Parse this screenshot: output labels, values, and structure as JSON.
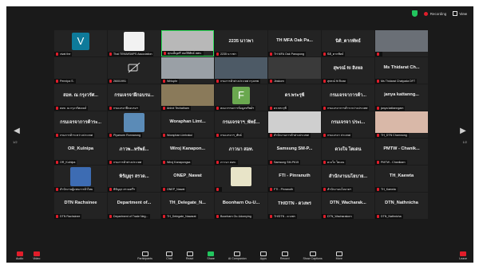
{
  "topbar": {
    "recording_label": "Recording",
    "view_label": "View"
  },
  "nav": {
    "left_page": "1/2",
    "right_page": "1/2"
  },
  "tiles": [
    {
      "type": "avatar",
      "avatar": "V",
      "avatar_color": "#0e7a9a",
      "sub": "vivat the"
    },
    {
      "type": "logo",
      "logo_color": "#f2f2f2",
      "sub": "Thai TEN/MSMPS Association"
    },
    {
      "type": "photo",
      "photo_color": "#b8b8b8",
      "speaking": true,
      "sub": "คุณเพ็ญศรี สมบัติพัทธ์ สพท."
    },
    {
      "type": "name",
      "name": "2235 นาวพา",
      "sub": "2235 นาวพา"
    },
    {
      "type": "name",
      "name": "TH MFA Oak Pa...",
      "sub": "TH MFA Oak Panupong"
    },
    {
      "type": "name",
      "name": "นิติ_ตากพัทธ์",
      "sub": "นิติ_ตากพัทธ์"
    },
    {
      "type": "photo",
      "photo_color": "#6a6f76",
      "sub": ""
    },
    {
      "type": "name",
      "name": "",
      "sub": "Pennipa S."
    },
    {
      "type": "camoff",
      "sub": "26001991"
    },
    {
      "type": "photo",
      "photo_color": "#9aa0a6",
      "sub": "Whisphr"
    },
    {
      "type": "photo",
      "photo_color": "#4d5a66",
      "sub": "กรมการค้าต่างประเทศ กรุงเทพ"
    },
    {
      "type": "photo",
      "photo_color": "#3a3a3a",
      "sub": "Jirakorn"
    },
    {
      "type": "name",
      "name": "สุพรณ์ fti สิงหล",
      "sub": "สุพรณ์ fti สิงหล"
    },
    {
      "type": "name",
      "name": "Ms Thidarat Ch...",
      "sub": "Ms Thidarat Chaiyada DFT"
    },
    {
      "type": "name",
      "name": "สอท. ณ กรุงวรัศ...",
      "sub": "สอท. ณ กรุงวรัศเคลล์"
    },
    {
      "type": "name",
      "name": "กรมเจรจาฝึกอบรม...",
      "sub": "กรมเจรจาฝึกอบรมฯ"
    },
    {
      "type": "photo",
      "photo_color": "#8a7a5a",
      "sub": "Anirot Techatham"
    },
    {
      "type": "avatar",
      "avatar": "F",
      "avatar_color": "#6aa84f",
      "sub": "คณะกรรมการข้อมูลทรัพย์ฯ"
    },
    {
      "type": "name",
      "name": "ดร.พระรุพี",
      "sub": "ดร.พระรุพี"
    },
    {
      "type": "name",
      "name": "กรมเจรจาการค้า...",
      "sub": "กรมเจรจาการค้าระหว่างประเทศ"
    },
    {
      "type": "name",
      "name": "janya kattanng...",
      "sub": "janya kattanngam"
    },
    {
      "type": "name",
      "name": "กรมเจรจาการค้าระ...",
      "sub": "กรมการค้าระหว่างประเทศ"
    },
    {
      "type": "logo",
      "logo_color": "#5b8bb7",
      "sub": "Piyarsorn Ronnarong"
    },
    {
      "type": "name",
      "name": "Woraphan Limt...",
      "sub": "Woraphan Limtrakul"
    },
    {
      "type": "name",
      "name": "กรมเจรจาฯ_พัทธ์...",
      "sub": "กรมเจรจาฯ_พัทธ์"
    },
    {
      "type": "photo",
      "photo_color": "#cfcfcf",
      "sub": "สำนักงานการค้าต่างประเทศ"
    },
    {
      "type": "name",
      "name": "กรมเจรจา ประเ...",
      "sub": "กรมเจรจา ประเทศ"
    },
    {
      "type": "photo",
      "photo_color": "#d9b8a8",
      "sub": "TH_DTN Chamnong"
    },
    {
      "type": "name",
      "name": "OR_Kulnipa",
      "sub": "OR_Kulnipa"
    },
    {
      "type": "name",
      "name": "ภาวพ...ทรัพย์...",
      "sub": "กรมการค้าต่างประเทศ"
    },
    {
      "type": "name",
      "name": "Wiroj Kanapon...",
      "sub": "Wiroj Kanapongsa"
    },
    {
      "type": "name",
      "name": "ภาวนา สอท.",
      "sub": "ภาวนา สอท."
    },
    {
      "type": "name",
      "name": "Samsung SM-P...",
      "sub": "Samsung SM-P615"
    },
    {
      "type": "name",
      "name": "ดวงใจ โตเดน",
      "sub": "ดวงใจ โตเดน"
    },
    {
      "type": "name",
      "name": "PMTW - Chanik...",
      "sub": "PMTW - Chanikarn"
    },
    {
      "type": "logo",
      "logo_color": "#3d6cb3",
      "sub": "สำนักงานผู้แทนการค้าไทย"
    },
    {
      "type": "name",
      "name": "พิรัญยุร สรวด...",
      "sub": "พิรัญยุร สรวดตรีฯ"
    },
    {
      "type": "name",
      "name": "ONEP_Nawat",
      "sub": "ONEP_Nawat"
    },
    {
      "type": "logo",
      "logo_color": "#e8e4c8",
      "sub": ""
    },
    {
      "type": "name",
      "name": "FTI - Pinranuth",
      "sub": "FTI - Pinranuth"
    },
    {
      "type": "name",
      "name": "สำนักงานนโยบาย...",
      "sub": "สำนักงานนโยบายฯ"
    },
    {
      "type": "name",
      "name": "TH_Kaewta",
      "sub": "TH_Kaewta"
    },
    {
      "type": "name",
      "name": "DTN Rachsinee",
      "sub": "DTN Rachsinee"
    },
    {
      "type": "name",
      "name": "Department of...",
      "sub": "Department of Trade Neg..."
    },
    {
      "type": "name",
      "name": "TH_Delegate_N...",
      "sub": "TH_Delegate_Nawarat"
    },
    {
      "type": "name",
      "name": "Boonharn Ou-U...",
      "sub": "Boonharn Ou-Udomying"
    },
    {
      "type": "name",
      "name": "TH/DTN - ดวงพร",
      "sub": "TH/DTN - ดวงพร"
    },
    {
      "type": "name",
      "name": "DTN_Wacharak...",
      "sub": "DTN_Wacharakorn"
    },
    {
      "type": "name",
      "name": "DTN_Nathnicha",
      "sub": "DTN_Nathnicha"
    }
  ],
  "toolbar": {
    "audio_label": "Audio",
    "video_label": "Video",
    "participants_label": "Participants",
    "chat_label": "Chat",
    "react_label": "React",
    "share_label": "Share",
    "ai_companion_label": "AI Companion",
    "apps_label": "Apps",
    "record_label": "Record",
    "show_captions_label": "Show Captions",
    "more_label": "More",
    "leave_label": "Leave"
  }
}
